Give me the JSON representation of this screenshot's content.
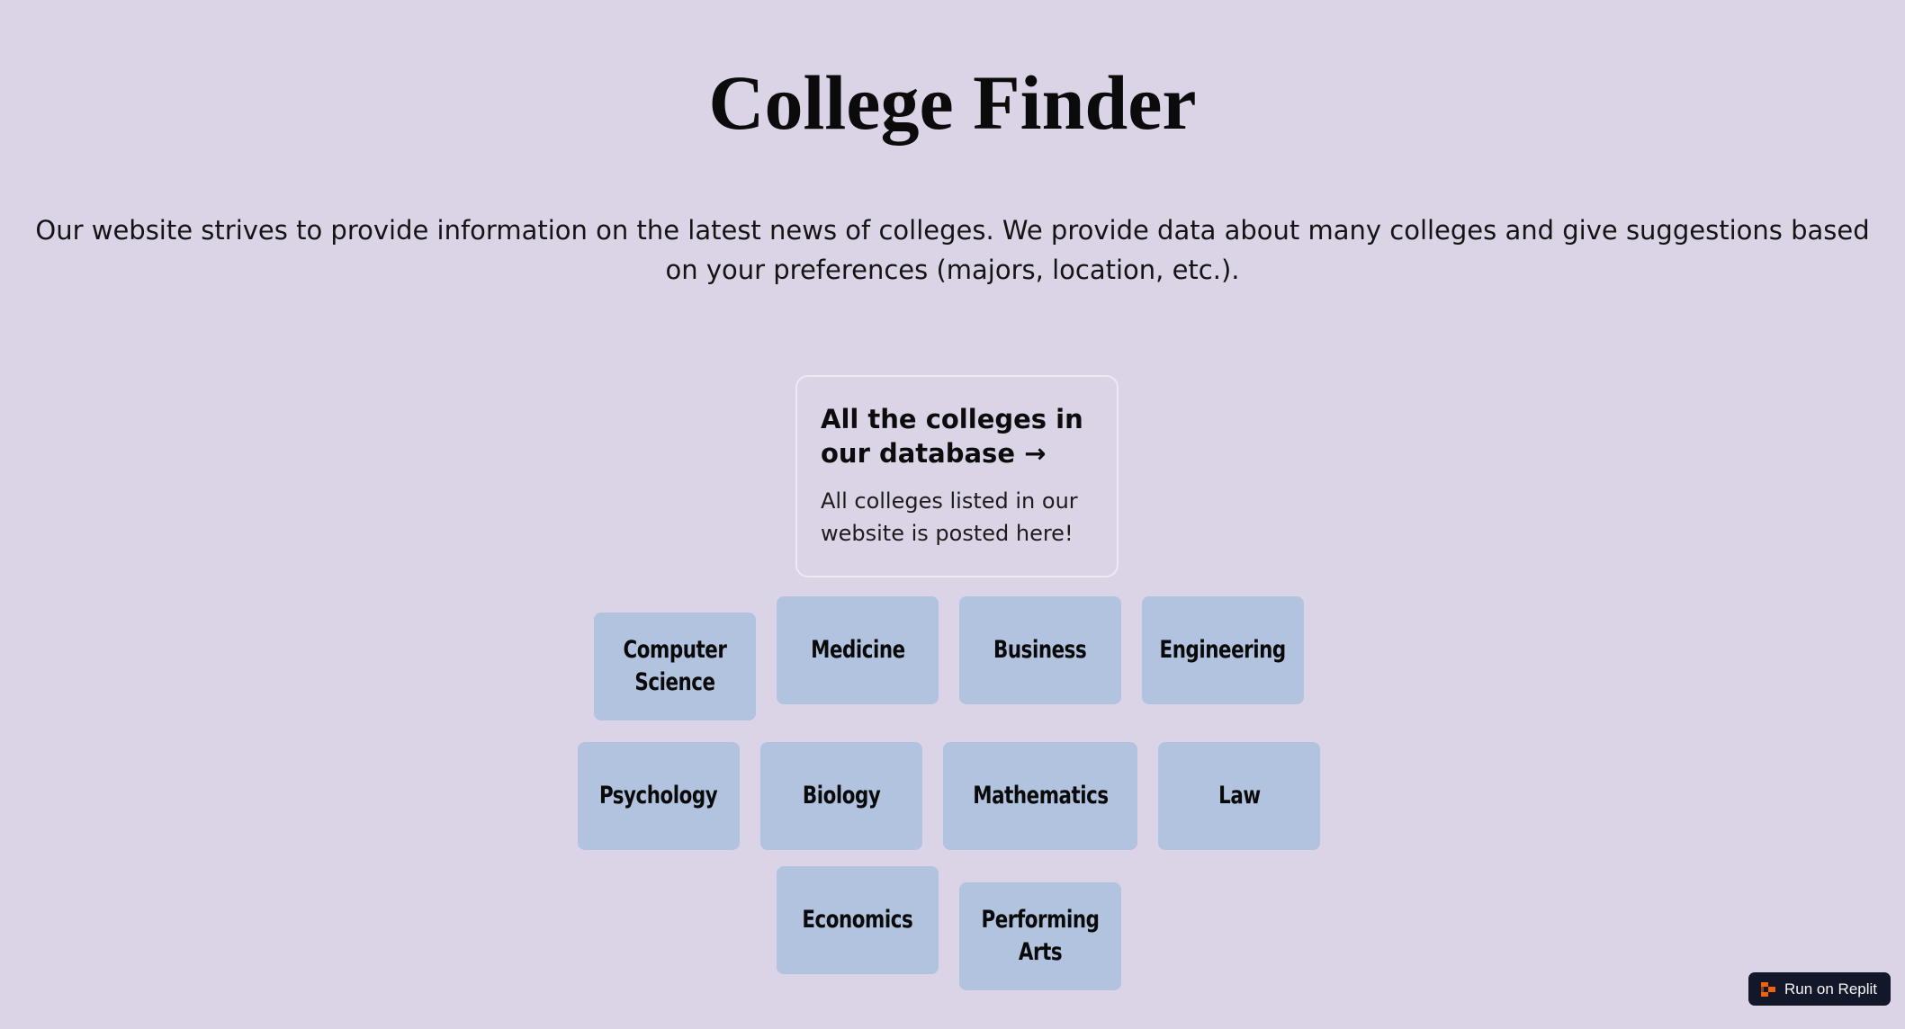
{
  "page": {
    "title": "College Finder",
    "intro": "Our website strives to provide information on the latest news of colleges. We provide data about many colleges and give suggestions based on your preferences (majors, location, etc.)."
  },
  "database_card": {
    "title": "All the colleges in our database →",
    "description": "All colleges listed in our website is posted here!"
  },
  "majors": [
    {
      "label": "Computer Science"
    },
    {
      "label": "Medicine"
    },
    {
      "label": "Business"
    },
    {
      "label": "Engineering"
    },
    {
      "label": "Psychology"
    },
    {
      "label": "Biology"
    },
    {
      "label": "Mathematics"
    },
    {
      "label": "Law"
    },
    {
      "label": "Economics"
    },
    {
      "label": "Performing Arts"
    }
  ],
  "replit": {
    "label": "Run on Replit",
    "icon": "replit-logo-icon"
  },
  "colors": {
    "background": "#dad4e6",
    "tile": "#b1c3df",
    "replit_bg": "#13172a",
    "replit_accent": "#f26207"
  }
}
